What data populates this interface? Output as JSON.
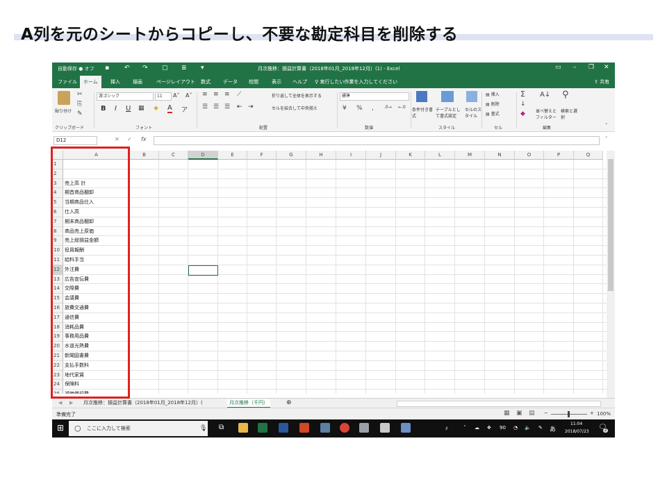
{
  "slide": {
    "title": "A列を元のシートからコピーし、不要な勘定科目を削除する"
  },
  "titlebar": {
    "autosave": "自動保存 ● オフ",
    "document": "月次推移：損益計算書（2018年01月_2018年12月）(1) - Excel",
    "icons": [
      "save-icon",
      "undo-icon",
      "redo-icon",
      "print-preview-icon",
      "form-icon",
      "customize-icon"
    ]
  },
  "tabs": [
    "ファイル",
    "ホーム",
    "挿入",
    "描画",
    "ページレイアウト",
    "数式",
    "データ",
    "校閲",
    "表示",
    "ヘルプ",
    "実行したい作業を入力してください",
    "共有"
  ],
  "ribbon": {
    "clipboard": {
      "paste": "貼り付け",
      "label": "クリップボード"
    },
    "font": {
      "name": "游ゴシック",
      "size": "11",
      "label": "フォント"
    },
    "align": {
      "wrap": "折り返して全体を表示する",
      "merge": "セルを結合して中央揃え",
      "label": "配置"
    },
    "number": {
      "format": "標準",
      "label": "数値"
    },
    "styles": {
      "cond": "条件付き書式",
      "table": "テーブルとして書式設定",
      "cell": "セルのスタイル",
      "label": "スタイル"
    },
    "cells": {
      "insert": "挿入",
      "delete": "削除",
      "format": "書式",
      "label": "セル"
    },
    "edit": {
      "sort": "並べ替えとフィルター",
      "find": "検索と選択",
      "label": "編集"
    }
  },
  "formula": {
    "namebox": "D12",
    "fx": "fx",
    "value": ""
  },
  "columns": [
    "A",
    "B",
    "C",
    "D",
    "E",
    "F",
    "G",
    "H",
    "I",
    "J",
    "K",
    "L",
    "M",
    "N",
    "O",
    "P",
    "Q"
  ],
  "rows": [
    {
      "n": "1",
      "a": ""
    },
    {
      "n": "2",
      "a": ""
    },
    {
      "n": "3",
      "a": "売上高 計"
    },
    {
      "n": "4",
      "a": "期首商品棚卸"
    },
    {
      "n": "5",
      "a": "当期商品仕入"
    },
    {
      "n": "6",
      "a": "仕入高"
    },
    {
      "n": "7",
      "a": "期末商品棚卸"
    },
    {
      "n": "8",
      "a": "商品売上原価"
    },
    {
      "n": "9",
      "a": "売上総損益金額"
    },
    {
      "n": "10",
      "a": "役員報酬"
    },
    {
      "n": "11",
      "a": "給料手当"
    },
    {
      "n": "12",
      "a": "外注費"
    },
    {
      "n": "13",
      "a": "広告宣伝費"
    },
    {
      "n": "14",
      "a": "交際費"
    },
    {
      "n": "15",
      "a": "会議費"
    },
    {
      "n": "16",
      "a": "旅費交通費"
    },
    {
      "n": "17",
      "a": "通信費"
    },
    {
      "n": "18",
      "a": "消耗品費"
    },
    {
      "n": "19",
      "a": "事務用品費"
    },
    {
      "n": "20",
      "a": "水道光熱費"
    },
    {
      "n": "21",
      "a": "新聞図書費"
    },
    {
      "n": "22",
      "a": "支払手数料"
    },
    {
      "n": "23",
      "a": "地代家賃"
    },
    {
      "n": "24",
      "a": "保険料"
    },
    {
      "n": "25",
      "a": "減価償却費"
    }
  ],
  "sheets": {
    "tab1": "月次推移：損益計算書（2018年01月_2018年12月）(",
    "tab2": "月次推移（千円）",
    "add": "⊕"
  },
  "status": {
    "ready": "準備完了",
    "zoom": "100%"
  },
  "taskbar": {
    "search": "ここに入力して検索",
    "time": "11:04",
    "date": "2018/07/23",
    "ime": "あ",
    "notify": "2"
  },
  "colors": {
    "excel_green": "#217346",
    "highlight_red": "#e02020"
  }
}
